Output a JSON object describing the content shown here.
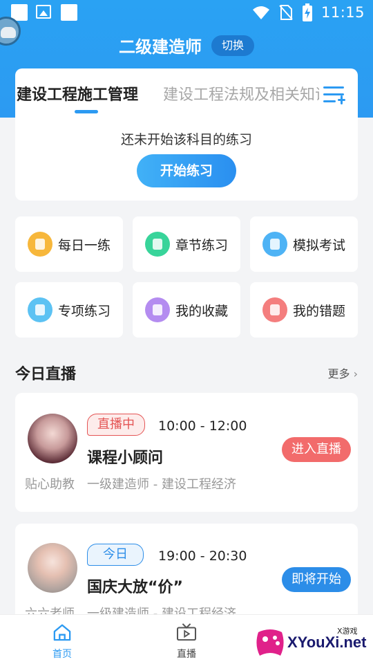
{
  "status_bar": {
    "time": "11:15"
  },
  "header": {
    "title": "二级建造师",
    "switch_label": "切换"
  },
  "tabs": [
    {
      "label": "建设工程施工管理",
      "active": true
    },
    {
      "label": "建设工程法规及相关知识",
      "active": false
    }
  ],
  "practice": {
    "empty_text": "还未开始该科目的练习",
    "start_label": "开始练习"
  },
  "features": [
    {
      "label": "每日一练",
      "icon": "calendar-icon",
      "color": "#f7b73b"
    },
    {
      "label": "章节练习",
      "icon": "document-icon",
      "color": "#38d49a"
    },
    {
      "label": "模拟考试",
      "icon": "pen-icon",
      "color": "#4eb3f5"
    },
    {
      "label": "专项练习",
      "icon": "clipboard-icon",
      "color": "#5cc2f3"
    },
    {
      "label": "我的收藏",
      "icon": "star-icon",
      "color": "#b48cf0"
    },
    {
      "label": "我的错题",
      "icon": "wrong-icon",
      "color": "#f47e7e"
    }
  ],
  "live_section": {
    "title": "今日直播",
    "more_label": "更多"
  },
  "live_items": [
    {
      "status": "直播中",
      "time": "10:00 - 12:00",
      "title": "课程小顾问",
      "teacher": "贴心助教",
      "subject": "一级建造师 - 建设工程经济",
      "action": "进入直播"
    },
    {
      "status": "今日",
      "time": "19:00 - 20:30",
      "title": "国庆大放“价”",
      "teacher": "六六老师",
      "subject": "一级建造师 - 建设工程经济",
      "action": "即将开始"
    }
  ],
  "bottom_nav": [
    {
      "label": "首页",
      "icon": "home-icon",
      "active": true
    },
    {
      "label": "直播",
      "icon": "live-tv-icon",
      "active": false
    }
  ],
  "watermark": {
    "text": "XYouXi.net",
    "small": "X游戏"
  },
  "colors": {
    "primary": "#2c9af2",
    "live_red": "#f26b6b",
    "upcoming_blue": "#2c8de8"
  }
}
